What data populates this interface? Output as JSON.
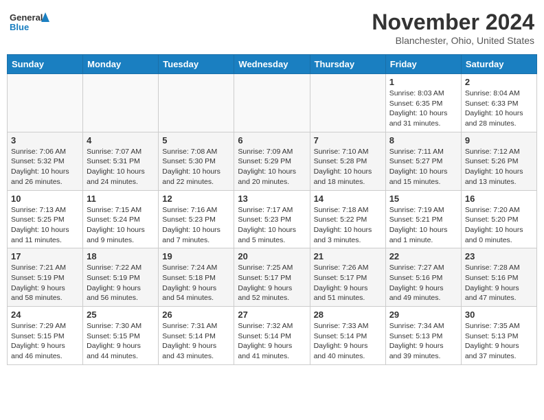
{
  "header": {
    "logo_line1": "General",
    "logo_line2": "Blue",
    "month": "November 2024",
    "location": "Blanchester, Ohio, United States"
  },
  "weekdays": [
    "Sunday",
    "Monday",
    "Tuesday",
    "Wednesday",
    "Thursday",
    "Friday",
    "Saturday"
  ],
  "weeks": [
    [
      {
        "day": "",
        "info": ""
      },
      {
        "day": "",
        "info": ""
      },
      {
        "day": "",
        "info": ""
      },
      {
        "day": "",
        "info": ""
      },
      {
        "day": "",
        "info": ""
      },
      {
        "day": "1",
        "info": "Sunrise: 8:03 AM\nSunset: 6:35 PM\nDaylight: 10 hours\nand 31 minutes."
      },
      {
        "day": "2",
        "info": "Sunrise: 8:04 AM\nSunset: 6:33 PM\nDaylight: 10 hours\nand 28 minutes."
      }
    ],
    [
      {
        "day": "3",
        "info": "Sunrise: 7:06 AM\nSunset: 5:32 PM\nDaylight: 10 hours\nand 26 minutes."
      },
      {
        "day": "4",
        "info": "Sunrise: 7:07 AM\nSunset: 5:31 PM\nDaylight: 10 hours\nand 24 minutes."
      },
      {
        "day": "5",
        "info": "Sunrise: 7:08 AM\nSunset: 5:30 PM\nDaylight: 10 hours\nand 22 minutes."
      },
      {
        "day": "6",
        "info": "Sunrise: 7:09 AM\nSunset: 5:29 PM\nDaylight: 10 hours\nand 20 minutes."
      },
      {
        "day": "7",
        "info": "Sunrise: 7:10 AM\nSunset: 5:28 PM\nDaylight: 10 hours\nand 18 minutes."
      },
      {
        "day": "8",
        "info": "Sunrise: 7:11 AM\nSunset: 5:27 PM\nDaylight: 10 hours\nand 15 minutes."
      },
      {
        "day": "9",
        "info": "Sunrise: 7:12 AM\nSunset: 5:26 PM\nDaylight: 10 hours\nand 13 minutes."
      }
    ],
    [
      {
        "day": "10",
        "info": "Sunrise: 7:13 AM\nSunset: 5:25 PM\nDaylight: 10 hours\nand 11 minutes."
      },
      {
        "day": "11",
        "info": "Sunrise: 7:15 AM\nSunset: 5:24 PM\nDaylight: 10 hours\nand 9 minutes."
      },
      {
        "day": "12",
        "info": "Sunrise: 7:16 AM\nSunset: 5:23 PM\nDaylight: 10 hours\nand 7 minutes."
      },
      {
        "day": "13",
        "info": "Sunrise: 7:17 AM\nSunset: 5:23 PM\nDaylight: 10 hours\nand 5 minutes."
      },
      {
        "day": "14",
        "info": "Sunrise: 7:18 AM\nSunset: 5:22 PM\nDaylight: 10 hours\nand 3 minutes."
      },
      {
        "day": "15",
        "info": "Sunrise: 7:19 AM\nSunset: 5:21 PM\nDaylight: 10 hours\nand 1 minute."
      },
      {
        "day": "16",
        "info": "Sunrise: 7:20 AM\nSunset: 5:20 PM\nDaylight: 10 hours\nand 0 minutes."
      }
    ],
    [
      {
        "day": "17",
        "info": "Sunrise: 7:21 AM\nSunset: 5:19 PM\nDaylight: 9 hours\nand 58 minutes."
      },
      {
        "day": "18",
        "info": "Sunrise: 7:22 AM\nSunset: 5:19 PM\nDaylight: 9 hours\nand 56 minutes."
      },
      {
        "day": "19",
        "info": "Sunrise: 7:24 AM\nSunset: 5:18 PM\nDaylight: 9 hours\nand 54 minutes."
      },
      {
        "day": "20",
        "info": "Sunrise: 7:25 AM\nSunset: 5:17 PM\nDaylight: 9 hours\nand 52 minutes."
      },
      {
        "day": "21",
        "info": "Sunrise: 7:26 AM\nSunset: 5:17 PM\nDaylight: 9 hours\nand 51 minutes."
      },
      {
        "day": "22",
        "info": "Sunrise: 7:27 AM\nSunset: 5:16 PM\nDaylight: 9 hours\nand 49 minutes."
      },
      {
        "day": "23",
        "info": "Sunrise: 7:28 AM\nSunset: 5:16 PM\nDaylight: 9 hours\nand 47 minutes."
      }
    ],
    [
      {
        "day": "24",
        "info": "Sunrise: 7:29 AM\nSunset: 5:15 PM\nDaylight: 9 hours\nand 46 minutes."
      },
      {
        "day": "25",
        "info": "Sunrise: 7:30 AM\nSunset: 5:15 PM\nDaylight: 9 hours\nand 44 minutes."
      },
      {
        "day": "26",
        "info": "Sunrise: 7:31 AM\nSunset: 5:14 PM\nDaylight: 9 hours\nand 43 minutes."
      },
      {
        "day": "27",
        "info": "Sunrise: 7:32 AM\nSunset: 5:14 PM\nDaylight: 9 hours\nand 41 minutes."
      },
      {
        "day": "28",
        "info": "Sunrise: 7:33 AM\nSunset: 5:14 PM\nDaylight: 9 hours\nand 40 minutes."
      },
      {
        "day": "29",
        "info": "Sunrise: 7:34 AM\nSunset: 5:13 PM\nDaylight: 9 hours\nand 39 minutes."
      },
      {
        "day": "30",
        "info": "Sunrise: 7:35 AM\nSunset: 5:13 PM\nDaylight: 9 hours\nand 37 minutes."
      }
    ]
  ]
}
